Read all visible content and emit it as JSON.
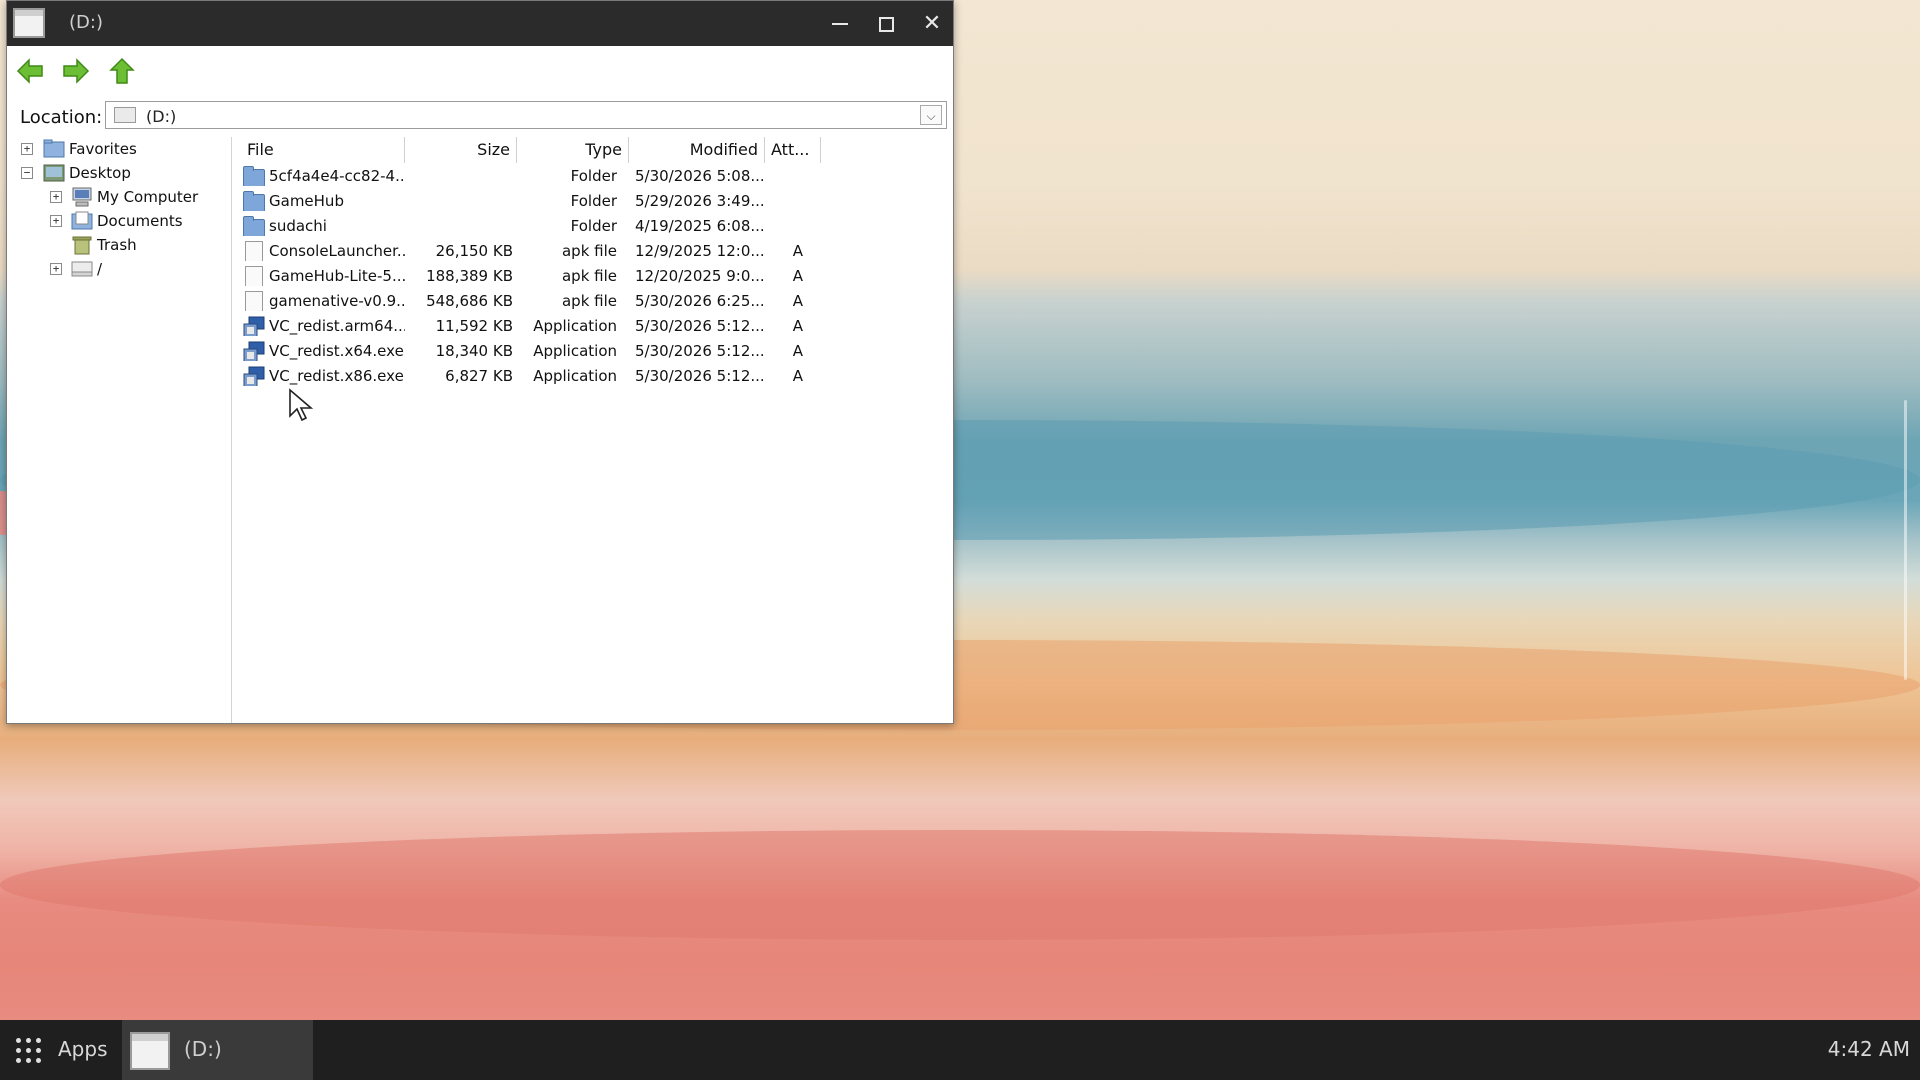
{
  "window": {
    "title": "(D:)",
    "minimize_icon": "minimize-icon",
    "maximize_icon": "maximize-icon",
    "close_icon": "close-icon",
    "close_glyph": "✕"
  },
  "toolbar": {
    "back_icon": "arrow-left-icon",
    "forward_icon": "arrow-right-icon",
    "up_icon": "arrow-up-icon",
    "accent": "#5fae2e"
  },
  "location": {
    "label": "Location:",
    "value": "(D:)",
    "dropdown_glyph": "⌵"
  },
  "tree": {
    "items": [
      {
        "label": "Favorites",
        "expander": "+",
        "icon": "favorites-folder-icon"
      },
      {
        "label": "Desktop",
        "expander": "−",
        "icon": "desktop-icon"
      },
      {
        "label": "My Computer",
        "expander": "+",
        "icon": "computer-icon"
      },
      {
        "label": "Documents",
        "expander": "+",
        "icon": "documents-folder-icon"
      },
      {
        "label": "Trash",
        "expander": "",
        "icon": "trash-icon"
      },
      {
        "label": "/",
        "expander": "+",
        "icon": "drive-icon"
      }
    ]
  },
  "columns": {
    "file": "File",
    "size": "Size",
    "type": "Type",
    "modified": "Modified",
    "attributes": "Att..."
  },
  "files": [
    {
      "name": "5cf4a4e4-cc82-4...",
      "size": "",
      "type": "Folder",
      "modified": "5/30/2026 5:08...",
      "att": "",
      "icon": "folder-icon"
    },
    {
      "name": "GameHub",
      "size": "",
      "type": "Folder",
      "modified": "5/29/2026 3:49...",
      "att": "",
      "icon": "folder-icon"
    },
    {
      "name": "sudachi",
      "size": "",
      "type": "Folder",
      "modified": "4/19/2025 6:08...",
      "att": "",
      "icon": "folder-icon"
    },
    {
      "name": "ConsoleLauncher...",
      "size": "26,150 KB",
      "type": "apk file",
      "modified": "12/9/2025 12:0...",
      "att": "A",
      "icon": "file-icon"
    },
    {
      "name": "GameHub-Lite-5....",
      "size": "188,389 KB",
      "type": "apk file",
      "modified": "12/20/2025 9:0...",
      "att": "A",
      "icon": "file-icon"
    },
    {
      "name": "gamenative-v0.9....",
      "size": "548,686 KB",
      "type": "apk file",
      "modified": "5/30/2026 6:25...",
      "att": "A",
      "icon": "file-icon"
    },
    {
      "name": "VC_redist.arm64...",
      "size": "11,592 KB",
      "type": "Application",
      "modified": "5/30/2026 5:12...",
      "att": "A",
      "icon": "application-icon"
    },
    {
      "name": "VC_redist.x64.exe",
      "size": "18,340 KB",
      "type": "Application",
      "modified": "5/30/2026 5:12...",
      "att": "A",
      "icon": "application-icon"
    },
    {
      "name": "VC_redist.x86.exe",
      "size": "6,827 KB",
      "type": "Application",
      "modified": "5/30/2026 5:12...",
      "att": "A",
      "icon": "application-icon"
    }
  ],
  "taskbar": {
    "apps_label": "Apps",
    "apps_icon": "app-grid-icon",
    "task_label": "(D:)",
    "clock": "4:42 AM"
  }
}
